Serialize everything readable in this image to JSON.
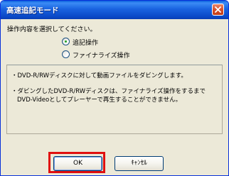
{
  "window": {
    "title": "高速追記モード"
  },
  "instruction": "操作内容を選択してください。",
  "options": [
    {
      "label": "追記操作",
      "selected": true
    },
    {
      "label": "ファイナライズ操作",
      "selected": false
    }
  ],
  "info": {
    "line1": "・DVD-R/RWディスクに対して動画ファイルをダビングします。",
    "line2": "・ダビングしたDVD-R/RWディスクは、ファイナライズ操作をするまで",
    "line3": "DVD-Videoとしてプレーヤーで再生することができません。"
  },
  "buttons": {
    "ok": "OK",
    "cancel": "ｷｬﾝｾﾙ"
  },
  "colors": {
    "titlebar": "#0a49c8",
    "dialog_bg": "#ece9d8",
    "highlight": "#e01010"
  }
}
